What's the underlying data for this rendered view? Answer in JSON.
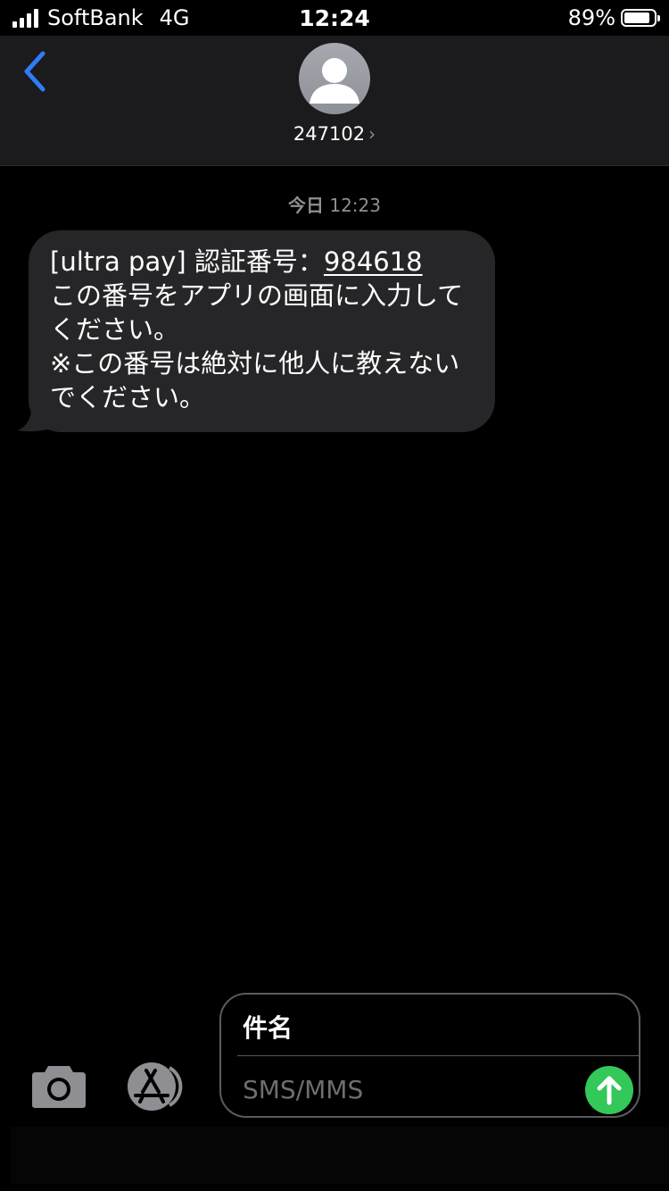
{
  "status_bar": {
    "carrier": "SoftBank",
    "network": "4G",
    "time": "12:24",
    "battery_percent": "89%",
    "battery_level": 0.89
  },
  "header": {
    "contact": "247102",
    "chevron": "›",
    "icons": {
      "back": "chevron-left-icon",
      "avatar": "person-icon"
    },
    "accent_color": "#2f7cf6"
  },
  "thread": {
    "timestamp_day": "今日",
    "timestamp_time": "12:23",
    "message": {
      "prefix": "[ultra pay] 認証番号：",
      "code": "984618",
      "body": "この番号をアプリの画面に入力してください。",
      "note": "※この番号は絶対に他人に教えないでください。"
    },
    "bubble_color": "#262628"
  },
  "composer": {
    "subject_label": "件名",
    "message_placeholder": "SMS/MMS",
    "send_color": "#34c759",
    "icons": {
      "camera": "camera-icon",
      "apps": "app-store-icon",
      "send": "arrow-up-icon"
    }
  }
}
